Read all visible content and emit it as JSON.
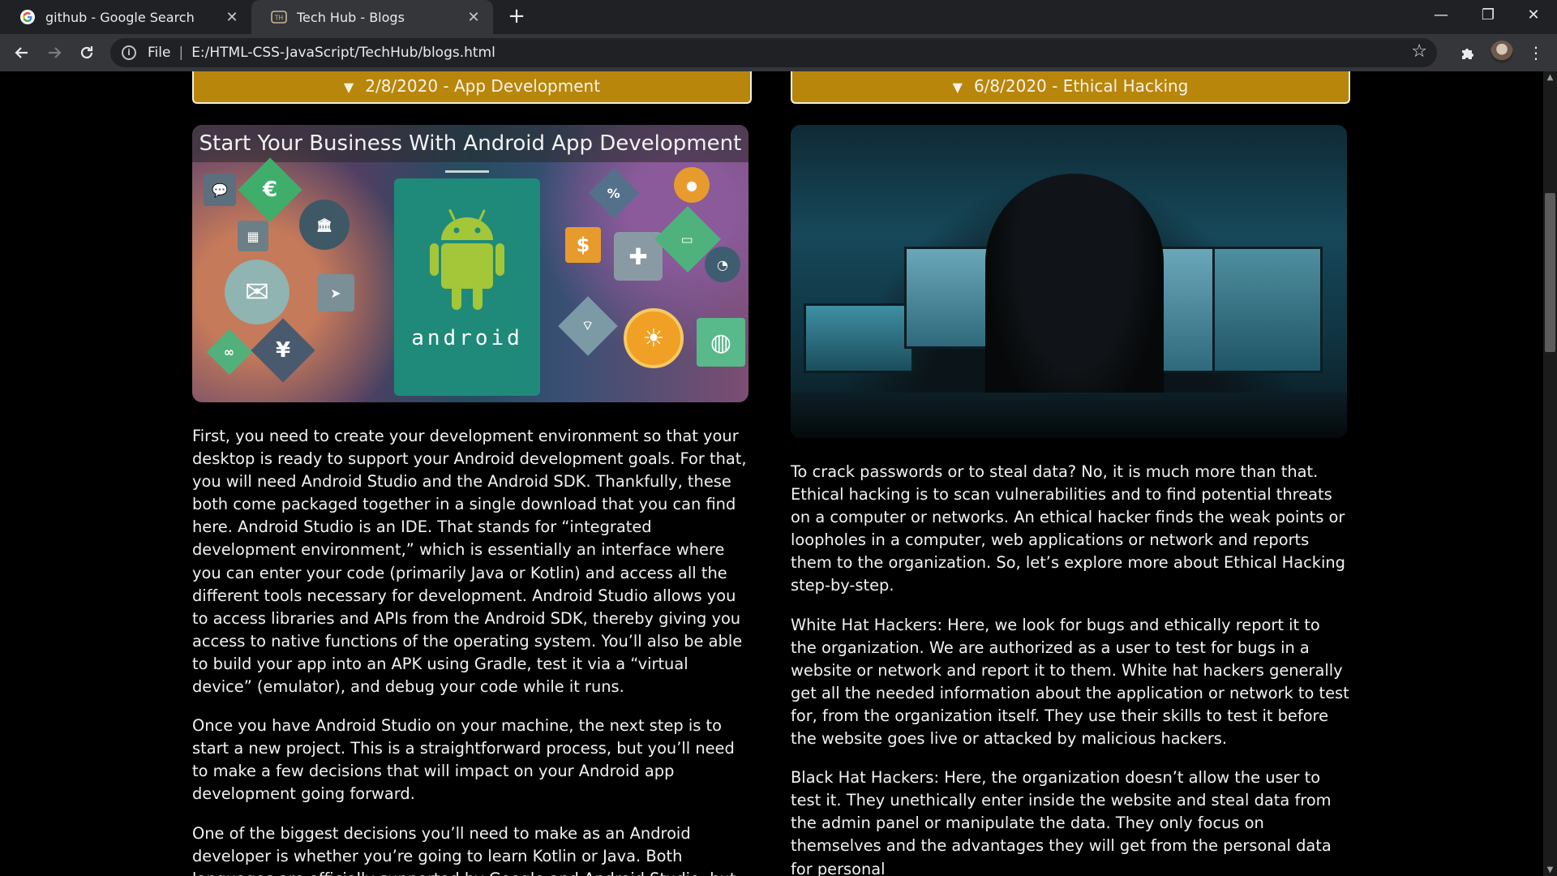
{
  "browser": {
    "tabs": [
      {
        "title": "github - Google Search",
        "active": false,
        "icon": "google-g-icon"
      },
      {
        "title": "Tech Hub - Blogs",
        "active": true,
        "icon": "techhub-favicon-icon"
      }
    ],
    "address": {
      "scheme_label": "File",
      "url": "E:/HTML-CSS-JavaScript/TechHub/blogs.html"
    }
  },
  "blogs": {
    "left": {
      "summary": "2/8/2020 - App Development",
      "image_title": "Start Your Business With Android App Development",
      "image_brand": "android",
      "paragraphs": [
        "First, you need to create your development environment so that your desktop is ready to support your Android development goals. For that, you will need Android Studio and the Android SDK. Thankfully, these both come packaged together in a single download that you can find here. Android Studio is an IDE. That stands for “integrated development environment,” which is essentially an interface where you can enter your code (primarily Java or Kotlin) and access all the different tools necessary for development. Android Studio allows you to access libraries and APIs from the Android SDK, thereby giving you access to native functions of the operating system. You’ll also be able to build your app into an APK using Gradle, test it via a “virtual device” (emulator), and debug your code while it runs.",
        "Once you have Android Studio on your machine, the next step is to start a new project. This is a straightforward process, but you’ll need to make a few decisions that will impact on your Android app development going forward.",
        "One of the biggest decisions you’ll need to make as an Android developer is whether you’re going to learn Kotlin or Java. Both languages are officially supported by Google and Android Studio, but"
      ]
    },
    "right": {
      "summary": "6/8/2020 - Ethical Hacking",
      "paragraphs": [
        "To crack passwords or to steal data? No, it is much more than that. Ethical hacking is to scan vulnerabilities and to find potential threats on a computer or networks. An ethical hacker finds the weak points or loopholes in a computer, web applications or network and reports them to the organization. So, let’s explore more about Ethical Hacking step-by-step.",
        "White Hat Hackers: Here, we look for bugs and ethically report it to the organization. We are authorized as a user to test for bugs in a website or network and report it to them. White hat hackers generally get all the needed information about the application or network to test for, from the organization itself. They use their skills to test it before the website goes live or attacked by malicious hackers.",
        "Black Hat Hackers: Here, the organization doesn’t allow the user to test it. They unethically enter inside the website and steal data from the admin panel or manipulate the data. They only focus on themselves and the advantages they will get from the personal data for personal"
      ]
    }
  },
  "colors": {
    "accent": "#b8860b",
    "page_bg": "#000000",
    "text": "#f2f2f2"
  },
  "icons": [
    "google-g-icon",
    "techhub-favicon-icon",
    "close-icon",
    "plus-icon",
    "minimize-icon",
    "restore-icon",
    "close-window-icon",
    "back-arrow-icon",
    "forward-arrow-icon",
    "reload-icon",
    "info-icon",
    "star-icon",
    "puzzle-extension-icon",
    "kebab-menu-icon",
    "triangle-down-icon"
  ]
}
